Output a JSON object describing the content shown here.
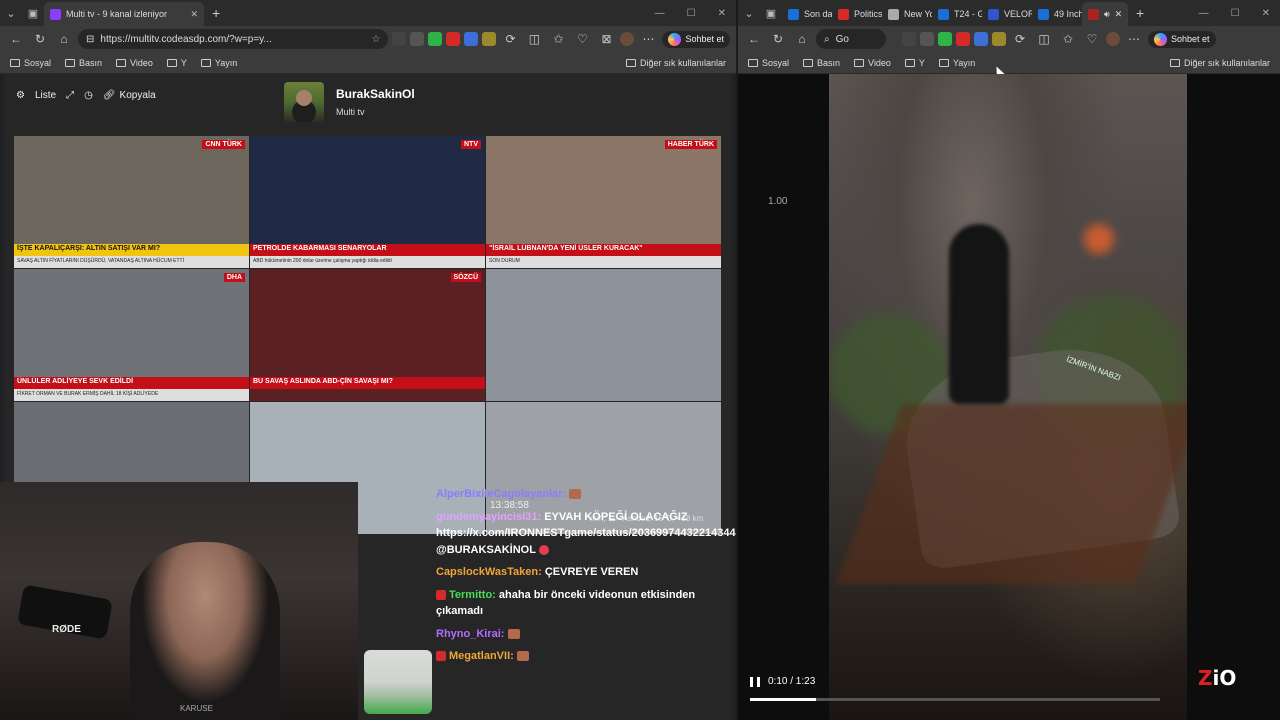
{
  "left_window": {
    "tabs": [
      {
        "label": "",
        "favicon_color": "#555"
      },
      {
        "label": "Multi tv - 9 kanal izleniyor",
        "favicon_color": "#8a3cff",
        "active": true
      }
    ],
    "address": {
      "url": "https://multitv.codeasdp.com/?w=p=y..."
    },
    "sohbet": "Sohbet et",
    "bookmarks": [
      "Sosyal",
      "Basın",
      "Video",
      "Y",
      "Yayın"
    ],
    "bookmarks_right": "Diğer sık kullanılanlar",
    "toolbar": {
      "liste": "Liste",
      "kopyala": "Kopyala"
    },
    "profile": {
      "name": "BurakSakinOl",
      "subtitle": "Multi tv"
    },
    "channels": [
      {
        "red": "İŞTE KAPALIÇARŞI: ALTIN SATIŞI VAR MI?",
        "grey": "SAVAŞ ALTIN FİYATLARINI DÜŞÜRDÜ, VATANDAŞ ALTINA HÜCUM ETTİ",
        "logo": "CNN TÜRK",
        "bg": "#6d665d"
      },
      {
        "red": "PETROLDE KABARMASI SENARYOLAR",
        "grey": "ABD hükümetinin 200 dolar üzerine çalışma yaptığı iddia edildi",
        "logo": "NTV",
        "bg": "#202a44"
      },
      {
        "red": "\"İSRAİL LÜBNAN'DA YENİ ÜSLER KURACAK\"",
        "grey": "SON DURUM",
        "logo": "HABER TÜRK",
        "bg": "#8a7566"
      },
      {
        "red": "ÜNLÜLER ADLİYEYE SEVK EDİLDİ",
        "grey": "FİKRET ORMAN VE BURAK ERMİŞ DAHİL 18 KİŞİ ADLİYEDE",
        "logo": "DHA",
        "bg": "#6f7378"
      },
      {
        "red": "BU SAVAŞ ASLINDA ABD-ÇİN SAVAŞI MI?",
        "grey": "",
        "logo": "SÖZCÜ",
        "bg": "#5a2024"
      },
      {
        "red": "",
        "grey": "",
        "logo": "",
        "bg": "#8c939b"
      },
      {
        "red": "",
        "grey": "",
        "logo": "",
        "bg": "#6a6e72"
      },
      {
        "red": "",
        "grey": "",
        "logo": "",
        "bg": "#a8b0b8"
      },
      {
        "red": "",
        "grey": "",
        "logo": "",
        "bg": "#9ea2a6"
      }
    ],
    "chat_time": "13:38:58",
    "weather": "m/h, ☁ • Ashdod: 15°C, • 18 km",
    "chat": [
      {
        "user": "AlperBixileCagolayanlar:",
        "text": ""
      },
      {
        "user": "gundemyayincisi31:",
        "text": "EYVAH KÖPEĞİ OLACAĞIZ https://x.com/IRONNESTgame/status/2036997443221434463 @BURAKSAKİNOL"
      },
      {
        "user": "CapslockWasTaken:",
        "text": "ÇEVREYE VEREN"
      },
      {
        "user": "Termitto:",
        "text": "ahaha bir önceki videonun etkisinden çıkamadı"
      },
      {
        "user": "Rhyno_Kirai:",
        "text": ""
      },
      {
        "user": "MegatlanVII:",
        "text": ""
      }
    ],
    "webcam_text": "RØDE",
    "webcam_corner": "KARUSE"
  },
  "right_window": {
    "tabs": [
      "Son da",
      "Politics",
      "New Yo",
      "T24 - G",
      "VELOR",
      "49 Inch",
      ""
    ],
    "tab_favicons": [
      "#1a6ed8",
      "#d92a2a",
      "#aaaaaa",
      "#1a6ed8",
      "#3355cc",
      "#1a6ed8",
      "#aa2222"
    ],
    "address": {
      "placeholder": "Go"
    },
    "sohbet": "Sohbet et",
    "bookmarks": [
      "Sosyal",
      "Basın",
      "Video",
      "Y",
      "Yayın"
    ],
    "bookmarks_right": "Diğer sık kullanılanlar",
    "speed": "1.00",
    "video_logo": "İZMİR'İN NABZI",
    "time": "0:10 / 1:23",
    "progress": 0.16,
    "brand": "Z",
    "brand_accent": "iO"
  }
}
